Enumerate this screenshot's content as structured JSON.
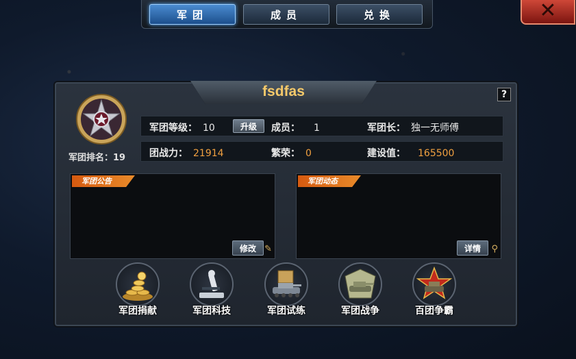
{
  "tabs": [
    {
      "label": "军团",
      "active": true
    },
    {
      "label": "成员",
      "active": false
    },
    {
      "label": "兑换",
      "active": false
    }
  ],
  "close_icon": "close-x-icon",
  "legion": {
    "name": "fsdfas",
    "rank_label": "军团排名：19",
    "level_label": "军团等级：",
    "level_value": "10",
    "upgrade_button": "升级",
    "members_label": "成员：",
    "members_value": "1",
    "leader_label": "军团长：",
    "leader_value": "独一无师傅",
    "power_label": "团战力：",
    "power_value": "21914",
    "prosperity_label": "繁荣：",
    "prosperity_value": "0",
    "construction_label": "建设值：",
    "construction_value": "165500"
  },
  "help_label": "?",
  "announcement": {
    "title": "军团公告",
    "button": "修改"
  },
  "activity": {
    "title": "军团动态",
    "button": "详情"
  },
  "features": [
    {
      "label": "军团捐献",
      "icon": "gold-coins-icon"
    },
    {
      "label": "军团科技",
      "icon": "microscope-icon"
    },
    {
      "label": "军团试练",
      "icon": "tank-trial-icon"
    },
    {
      "label": "军团战争",
      "icon": "tank-war-icon"
    },
    {
      "label": "百团争霸",
      "icon": "star-tank-icon"
    }
  ],
  "colors": {
    "accent_orange": "#f0a040",
    "title_gold": "#f5c96a",
    "tab_active": "#4a8bd0"
  }
}
